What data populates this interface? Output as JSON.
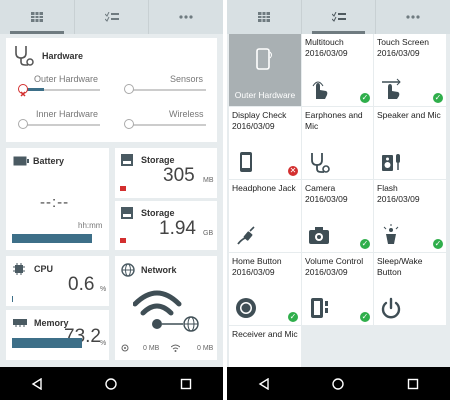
{
  "left": {
    "hardware": {
      "title": "Hardware",
      "outer": "Outer Hardware",
      "sensors": "Sensors",
      "inner": "Inner Hardware",
      "wireless": "Wireless"
    },
    "battery": {
      "title": "Battery",
      "value": "--:--",
      "unit": "hh:mm"
    },
    "storage1": {
      "title": "Storage",
      "value": "305",
      "unit": "MB"
    },
    "storage2": {
      "title": "Storage",
      "value": "1.94",
      "unit": "GB"
    },
    "cpu": {
      "title": "CPU",
      "value": "0.6",
      "unit": "%"
    },
    "memory": {
      "title": "Memory",
      "value": "73.2",
      "unit": "%"
    },
    "network": {
      "title": "Network",
      "rx": "0 MB",
      "tx": "0 MB"
    }
  },
  "right": {
    "tests": [
      {
        "name": "Outer Hardware",
        "date": "",
        "status": "selected",
        "icon": "phone-icon"
      },
      {
        "name": "Multitouch",
        "date": "2016/03/09",
        "status": "ok",
        "icon": "touch-icon"
      },
      {
        "name": "Touch Screen",
        "date": "2016/03/09",
        "status": "ok",
        "icon": "swipe-icon"
      },
      {
        "name": "Display Check",
        "date": "2016/03/09",
        "status": "error",
        "icon": "display-icon"
      },
      {
        "name": "Earphones and Mic",
        "date": "",
        "status": "none",
        "icon": "stethoscope-icon"
      },
      {
        "name": "Speaker and Mic",
        "date": "",
        "status": "none",
        "icon": "speaker-icon"
      },
      {
        "name": "Headphone Jack",
        "date": "",
        "status": "none",
        "icon": "plug-icon"
      },
      {
        "name": "Camera",
        "date": "2016/03/09",
        "status": "ok",
        "icon": "camera-icon"
      },
      {
        "name": "Flash",
        "date": "2016/03/09",
        "status": "ok",
        "icon": "flash-icon"
      },
      {
        "name": "Home Button",
        "date": "2016/03/09",
        "status": "ok",
        "icon": "home-button-icon"
      },
      {
        "name": "Volume Control",
        "date": "2016/03/09",
        "status": "ok",
        "icon": "volume-button-icon"
      },
      {
        "name": "Sleep/Wake Button",
        "date": "",
        "status": "none",
        "icon": "power-icon"
      },
      {
        "name": "Receiver and Mic",
        "date": "",
        "status": "none",
        "icon": "receiver-icon"
      }
    ]
  },
  "colors": {
    "accent": "#3d6f88",
    "ok": "#2fae4b",
    "error": "#d32f2f",
    "selected": "#a9b0b3"
  },
  "levels": {
    "cpu_fraction": 0.006,
    "memory_fraction": 0.732,
    "storage1_fraction": 0.04,
    "storage2_fraction": 0.04
  }
}
